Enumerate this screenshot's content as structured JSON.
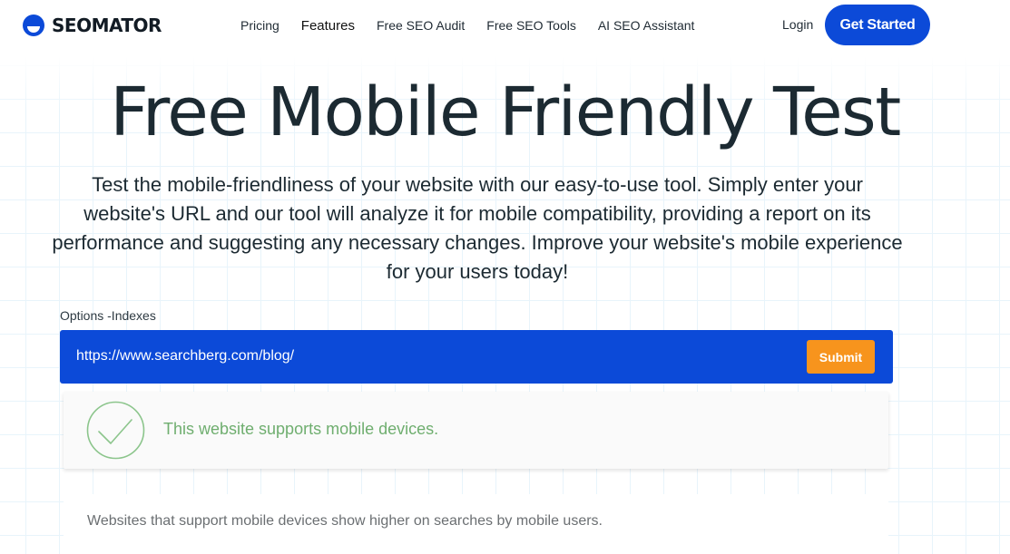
{
  "nav": {
    "logo_text": "SEOMATOR",
    "links": [
      "Pricing",
      "Features",
      "Free SEO Audit",
      "Free SEO Tools",
      "AI SEO Assistant"
    ],
    "login": "Login",
    "cta": "Get Started"
  },
  "hero": {
    "title": "Free Mobile Friendly Test",
    "description": "Test the mobile-friendliness of your website with our easy-to-use tool. Simply enter your website's URL and our tool will analyze it for mobile compatibility, providing a report on its performance and suggesting any necessary changes. Improve your website's mobile experience for your users today!"
  },
  "form": {
    "options_label": "Options -Indexes",
    "url_value": "https://www.searchberg.com/blog/",
    "submit_label": "Submit"
  },
  "result": {
    "message": "This website supports mobile devices.",
    "info": "Websites that support mobile devices show higher on searches by mobile users."
  },
  "colors": {
    "brand_blue": "#0c4ad8",
    "submit_orange": "#f7941d",
    "success_green": "#6fae6f"
  },
  "icons": {
    "logo": "seomator-logo-icon",
    "check": "check-circle-icon"
  }
}
